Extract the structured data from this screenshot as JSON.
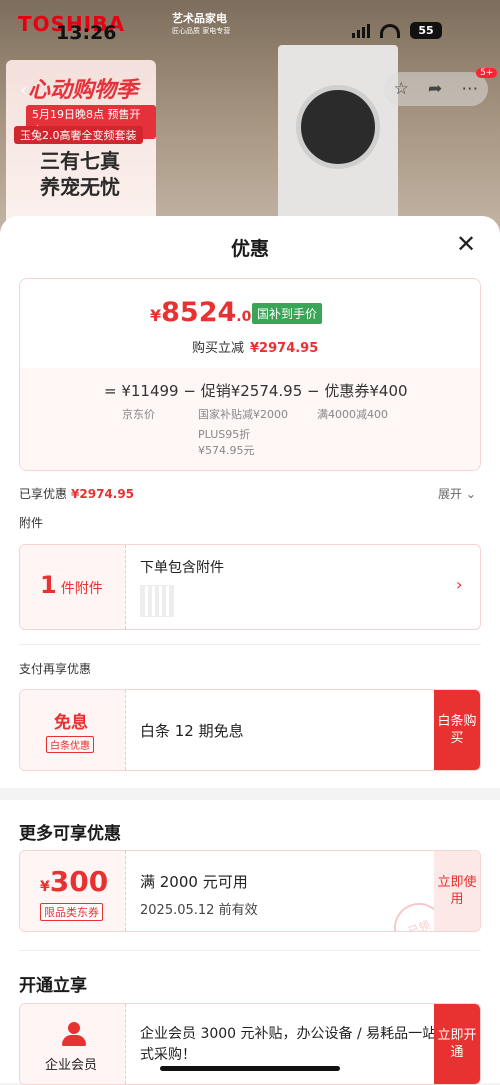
{
  "status": {
    "time": "13:26",
    "battery": "55"
  },
  "background": {
    "brand": "TOSHIBA",
    "store_name": "艺术品家电",
    "store_sub": "匠心品质 家电专营",
    "promo_title": "心动购物季",
    "promo_date": "5月19日晚8点 预售开启",
    "promo_line": "玉兔2.0高奢全变频套装",
    "promo_slogan1": "三有七真",
    "promo_slogan2": "养宠无忧",
    "badge": "5+"
  },
  "sheet": {
    "title": "优惠",
    "price": {
      "yen": "¥",
      "integer": "8524",
      "decimal": ".05",
      "tag": "国补到手价"
    },
    "instant": {
      "label": "购买立减",
      "value": "¥2974.95"
    },
    "calc": {
      "line": "= ¥11499 − 促销¥2574.95 − 优惠券¥400",
      "jd_label": "京东价",
      "promo_sub1": "国家补贴减¥2000",
      "promo_sub2": "PLUS95折",
      "promo_sub3": "¥574.95元",
      "coupon_sub": "满4000减400"
    },
    "enjoyed": {
      "label": "已享优惠",
      "value": "¥2974.95",
      "expand": "展开"
    },
    "accessory": {
      "section": "附件",
      "count": "1",
      "unit": "件附件",
      "title": "下单包含附件"
    },
    "pay": {
      "section": "支付再享优惠",
      "title": "免息",
      "tag": "白条优惠",
      "desc": "白条 12 期免息",
      "button": "白条购买"
    },
    "more": {
      "title": "更多可享优惠",
      "coupon": {
        "yen": "¥",
        "value": "300",
        "tag": "限品类东券",
        "cond": "满 2000 元可用",
        "date": "2025.05.12 前有效",
        "button": "立即使用",
        "stamp": "已领"
      }
    },
    "open": {
      "title": "开通立享",
      "member": {
        "label": "企业会员",
        "desc": "企业会员 3000 元补贴，办公设备 / 易耗品一站式采购！",
        "button": "立即开通"
      }
    }
  }
}
